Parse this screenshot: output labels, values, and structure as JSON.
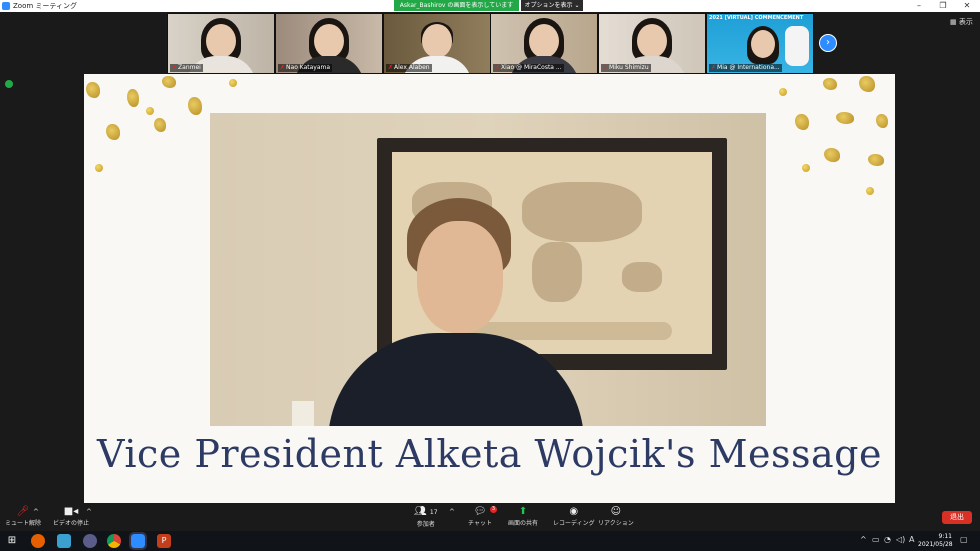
{
  "window": {
    "title": "Zoom ミーティング",
    "share_banner": "Askar_Bashirov の画面を表示しています",
    "options_label": "オプションを表示 ⌄",
    "view_label": "表示"
  },
  "participants": [
    {
      "name": "Zanmei"
    },
    {
      "name": "Nao Katayama"
    },
    {
      "name": "Alex Alaben"
    },
    {
      "name": "Xiao @ MiraCosta ..."
    },
    {
      "name": "Miku Shimizu"
    },
    {
      "name": "Mia @ Internationa..."
    }
  ],
  "mia_slide_text": "2021 [VIRTUAL] COMMENCEMENT",
  "slide": {
    "title": "Vice President Alketa Wojcik's Message"
  },
  "toolbar": {
    "mute_label": "ミュート解除",
    "video_label": "ビデオの停止",
    "participants_label": "参加者",
    "participants_count": "17",
    "chat_label": "チャット",
    "chat_badge": "3",
    "share_label": "画面の共有",
    "record_label": "レコーディング",
    "reaction_label": "リアクション",
    "leave_label": "退出"
  },
  "taskbar": {
    "time": "9:11",
    "date": "2021/05/28",
    "ime": "A"
  },
  "colors": {
    "zoom_blue": "#2d8cff",
    "share_green": "#23a847",
    "leave_red": "#d93025",
    "title_navy": "#2c3a64",
    "gold": "#d4af37"
  }
}
